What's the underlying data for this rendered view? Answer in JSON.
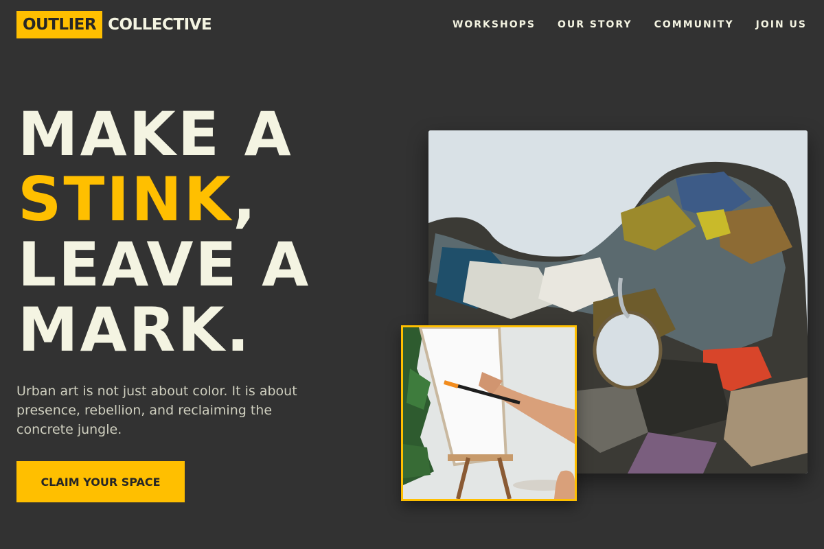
{
  "brand": {
    "highlight": "OUTLIER",
    "rest": "COLLECTIVE"
  },
  "nav": {
    "items": [
      "WORKSHOPS",
      "OUR STORY",
      "COMMUNITY",
      "JOIN US"
    ]
  },
  "hero": {
    "line1": "MAKE A",
    "line2_highlight": "STINK",
    "line2_rest": ",",
    "line3": "LEAVE A",
    "line4": "MARK.",
    "lead": "Urban art is not just about color. It is about presence, rebellion, and reclaiming the concrete jungle.",
    "cta": "CLAIM YOUR SPACE"
  },
  "images": {
    "main_icon": "paint-palette-photo",
    "inset_icon": "painting-at-easel-photo"
  },
  "colors": {
    "background": "#323232",
    "accent": "#ffbf00",
    "text": "#f4f4e2",
    "muted_text": "#cfcfbf"
  }
}
